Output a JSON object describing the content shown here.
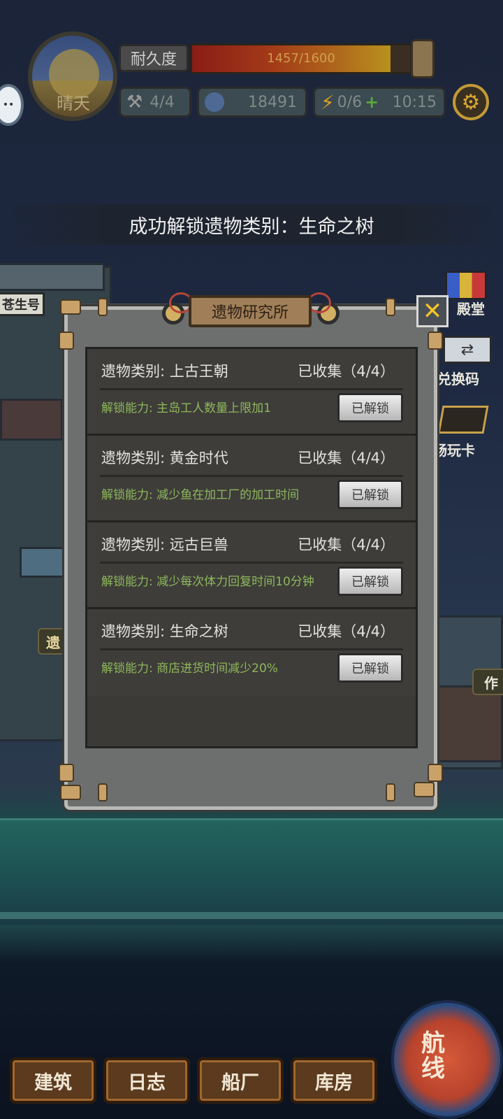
{
  "hud": {
    "weather": "晴天",
    "durability_label": "耐久度",
    "durability_text": "1457/1600",
    "durability_fraction": 0.91,
    "tools": "4/4",
    "coins": "18491",
    "energy": "0/6",
    "timer": "10:15"
  },
  "toast": "成功解锁遗物类别：生命之树",
  "side": {
    "left_sign": "苍生号",
    "left_tag": "遗",
    "right_rank": "殿堂",
    "right_exchange": "兑换码",
    "right_card": "畅玩卡",
    "right_work": "作"
  },
  "panel": {
    "title": "遗物研究所",
    "close": "✕",
    "items": [
      {
        "category": "遗物类别: 上古王朝",
        "collected": "已收集（4/4）",
        "ability": "解锁能力: 主岛工人数量上限加1",
        "button": "已解锁"
      },
      {
        "category": "遗物类别: 黄金时代",
        "collected": "已收集（4/4）",
        "ability": "解锁能力: 减少鱼在加工厂的加工时间",
        "button": "已解锁"
      },
      {
        "category": "遗物类别: 远古巨兽",
        "collected": "已收集（4/4）",
        "ability": "解锁能力: 减少每次体力回复时间10分钟",
        "button": "已解锁"
      },
      {
        "category": "遗物类别: 生命之树",
        "collected": "已收集（4/4）",
        "ability": "解锁能力: 商店进货时间减少20%",
        "button": "已解锁"
      }
    ]
  },
  "nav": {
    "build": "建筑",
    "log": "日志",
    "shipyard": "船厂",
    "warehouse": "库房",
    "voyage": "航线"
  },
  "colors": {
    "accent": "#f3c425",
    "ability_green": "#8eb85a"
  }
}
